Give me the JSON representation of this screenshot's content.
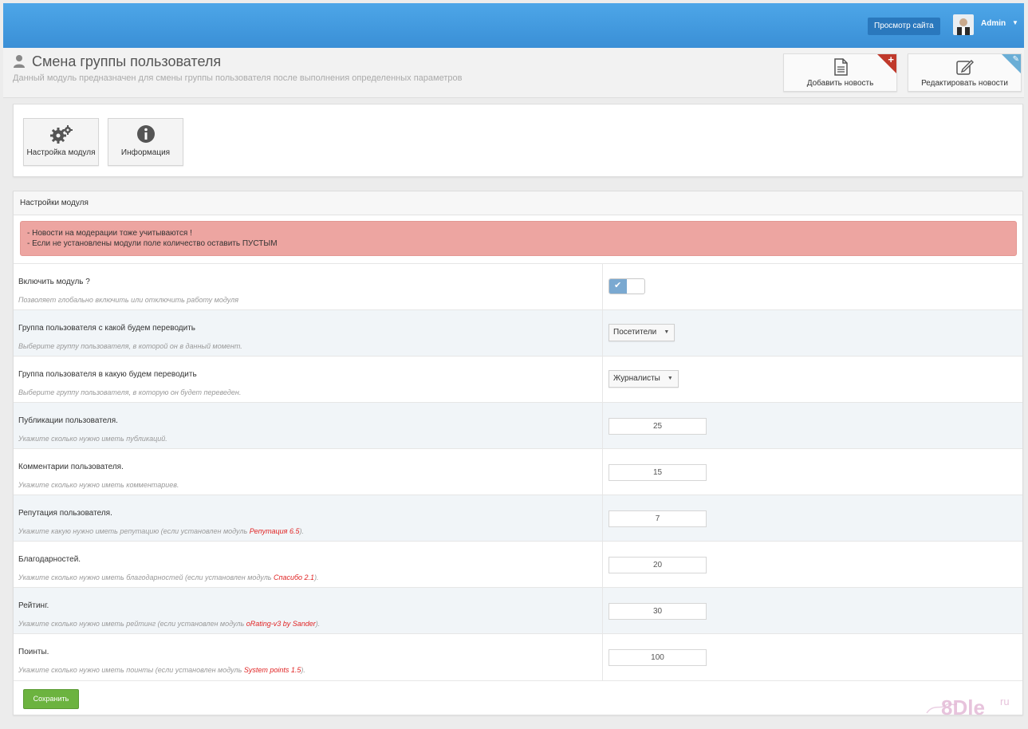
{
  "topbar": {
    "view_site_label": "Просмотр сайта",
    "user_name": "Admin"
  },
  "header": {
    "title": "Смена группы пользователя",
    "subtitle": "Данный модуль предназначен для смены группы пользователя после выполнения определенных параметров",
    "add_news_label": "Добавить новость",
    "edit_news_label": "Редактировать новости"
  },
  "tiles": {
    "settings_label": "Настройка модуля",
    "info_label": "Информация"
  },
  "settings_panel": {
    "heading": "Настройки модуля",
    "alert_line1": "- Новости на модерации тоже учитываются !",
    "alert_line2": "- Если не установлены модули поле количество оставить ПУСТЫМ"
  },
  "rows": [
    {
      "label": "Включить модуль ?",
      "hint": "Позволяет глобально включить или отключить работу модуля",
      "enabled": true
    },
    {
      "label": "Группа пользователя с какой будем переводить",
      "hint": "Выберите группу пользователя, в которой он в данный момент.",
      "value": "Посетители"
    },
    {
      "label": "Группа пользователя в какую будем переводить",
      "hint": "Выберите группу пользователя, в которую он будет переведен.",
      "value": "Журналисты"
    },
    {
      "label": "Публикации пользователя.",
      "hint": "Укажите сколько нужно иметь публикаций.",
      "value": "25"
    },
    {
      "label": "Комментарии пользователя.",
      "hint": "Укажите сколько нужно иметь комментариев.",
      "value": "15"
    },
    {
      "label": "Репутация пользователя.",
      "hint_pre": "Укажите какую нужно иметь репутацию (если установлен модуль ",
      "hint_link": "Репутация 6.5",
      "hint_post": ").",
      "value": "7"
    },
    {
      "label": "Благодарностей.",
      "hint_pre": "Укажите сколько нужно иметь благодарностей (если установлен модуль ",
      "hint_link": "Спасибо 2.1",
      "hint_post": ").",
      "value": "20"
    },
    {
      "label": "Рейтинг.",
      "hint_pre": "Укажите сколько нужно иметь рейтинг (если установлен модуль ",
      "hint_link": "oRating-v3 by Sander",
      "hint_post": ").",
      "value": "30"
    },
    {
      "label": "Поинты.",
      "hint_pre": "Укажите сколько нужно иметь поинты (если установлен модуль ",
      "hint_link": "System points 1.5",
      "hint_post": ").",
      "value": "100"
    }
  ],
  "save_label": "Сохранить",
  "watermark": {
    "brand": "8Dle",
    "tld": "ru"
  },
  "colors": {
    "topbar": "#3a8fd6",
    "alert": "#eda5a1",
    "save_button": "#6cb33f",
    "module_link": "#e02424"
  }
}
